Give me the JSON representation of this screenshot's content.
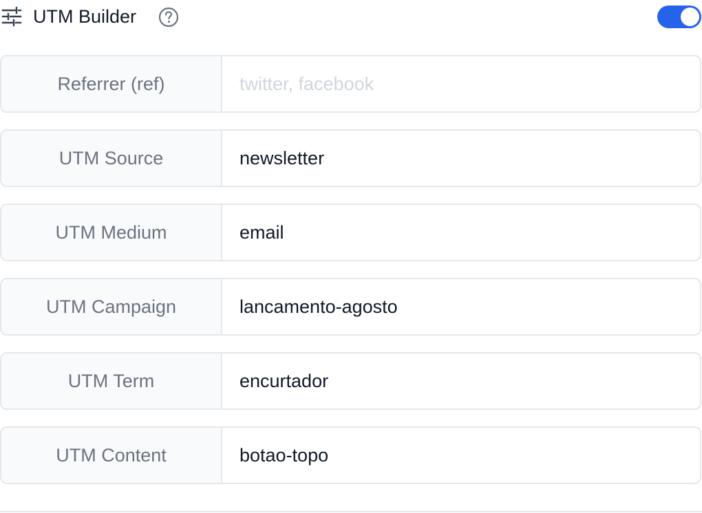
{
  "header": {
    "title": "UTM Builder",
    "icon": "sliders-icon",
    "help_icon": "help-circle-icon",
    "toggle_on": true,
    "accent_color": "#2563eb"
  },
  "fields": [
    {
      "label": "Referrer (ref)",
      "value": "",
      "placeholder": "twitter, facebook"
    },
    {
      "label": "UTM Source",
      "value": "newsletter",
      "placeholder": ""
    },
    {
      "label": "UTM Medium",
      "value": "email",
      "placeholder": ""
    },
    {
      "label": "UTM Campaign",
      "value": "lancamento-agosto",
      "placeholder": ""
    },
    {
      "label": "UTM Term",
      "value": "encurtador",
      "placeholder": ""
    },
    {
      "label": "UTM Content",
      "value": "botao-topo",
      "placeholder": ""
    }
  ]
}
